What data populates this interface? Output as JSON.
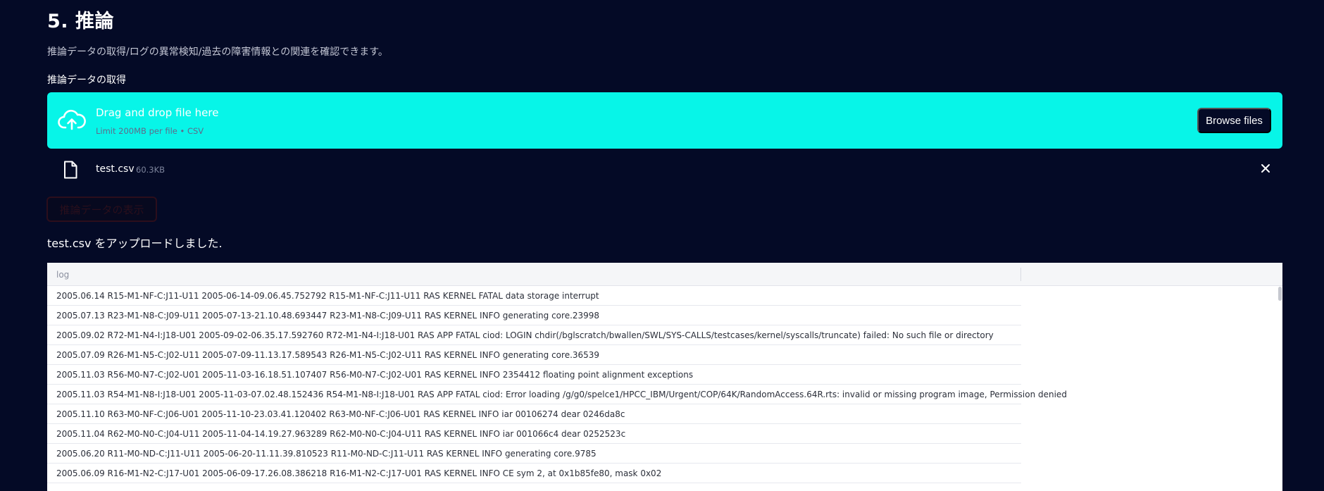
{
  "section": {
    "title": "5. 推論",
    "description": "推論データの取得/ログの異常検知/過去の障害情報との関連を確認できます。",
    "subheader": "推論データの取得"
  },
  "uploader": {
    "drag_label": "Drag and drop file here",
    "limit_label": "Limit 200MB per file • CSV",
    "browse_label": "Browse files",
    "icon": "cloud-upload-icon"
  },
  "uploaded_file": {
    "name": "test.csv",
    "size": "60.3KB"
  },
  "show_button_label": "推論データの表示",
  "upload_message": "test.csv をアップロードしました.",
  "table": {
    "columns": [
      "log"
    ],
    "rows": [
      "2005.06.14 R15-M1-NF-C:J11-U11 2005-06-14-09.06.45.752792 R15-M1-NF-C:J11-U11 RAS KERNEL FATAL data storage interrupt",
      "2005.07.13 R23-M1-N8-C:J09-U11 2005-07-13-21.10.48.693447 R23-M1-N8-C:J09-U11 RAS KERNEL INFO generating core.23998",
      "2005.09.02 R72-M1-N4-I:J18-U01 2005-09-02-06.35.17.592760 R72-M1-N4-I:J18-U01 RAS APP FATAL ciod: LOGIN chdir(/bglscratch/bwallen/SWL/SYS-CALLS/testcases/kernel/syscalls/truncate) failed: No such file or directory",
      "2005.07.09 R26-M1-N5-C:J02-U11 2005-07-09-11.13.17.589543 R26-M1-N5-C:J02-U11 RAS KERNEL INFO generating core.36539",
      "2005.11.03 R56-M0-N7-C:J02-U01 2005-11-03-16.18.51.107407 R56-M0-N7-C:J02-U01 RAS KERNEL INFO 2354412 floating point alignment exceptions",
      "2005.11.03 R54-M1-N8-I:J18-U01 2005-11-03-07.02.48.152436 R54-M1-N8-I:J18-U01 RAS APP FATAL ciod: Error loading /g/g0/spelce1/HPCC_IBM/Urgent/COP/64K/RandomAccess.64R.rts: invalid or missing program image, Permission denied",
      "2005.11.10 R63-M0-NF-C:J06-U01 2005-11-10-23.03.41.120402 R63-M0-NF-C:J06-U01 RAS KERNEL INFO iar 00106274 dear 0246da8c",
      "2005.11.04 R62-M0-N0-C:J04-U11 2005-11-04-14.19.27.963289 R62-M0-N0-C:J04-U11 RAS KERNEL INFO iar 001066c4 dear 0252523c",
      "2005.06.20 R11-M0-ND-C:J11-U11 2005-06-20-11.11.39.810523 R11-M0-ND-C:J11-U11 RAS KERNEL INFO generating core.9785",
      "2005.06.09 R16-M1-N2-C:J17-U01 2005-06-09-17.26.08.386218 R16-M1-N2-C:J17-U01 RAS KERNEL INFO CE sym 2, at 0x1b85fe80, mask 0x02"
    ]
  },
  "colors": {
    "background": "#040a26",
    "dropzone": "#07f5e8",
    "button": "#040a26"
  }
}
